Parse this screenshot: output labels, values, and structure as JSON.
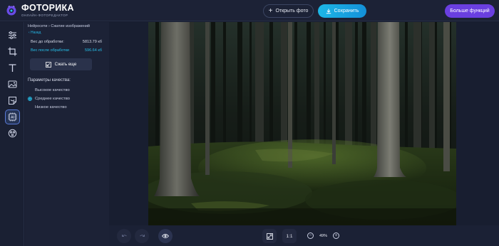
{
  "app": {
    "title": "ФОТОРИКА",
    "subtitle": "ОНЛАЙН-ФОТОРЕДАКТОР"
  },
  "header": {
    "open_label": "Открыть фото",
    "save_label": "Сохранить",
    "more_label": "Больше функций"
  },
  "toolbar": {
    "tools": [
      {
        "name": "adjust-icon"
      },
      {
        "name": "crop-icon"
      },
      {
        "name": "text-icon"
      },
      {
        "name": "image-icon"
      },
      {
        "name": "sticker-icon"
      },
      {
        "name": "ai-icon",
        "active": true
      },
      {
        "name": "effects-icon"
      }
    ]
  },
  "panel": {
    "breadcrumb": "Нейросети › Сжатие изображений",
    "back_label": "‹ Назад",
    "weight_before_label": "Вес до обработки:",
    "weight_before_value": "5813.79 кб",
    "weight_after_label": "Вес после обработки",
    "weight_after_value": "596.64 кб",
    "compress_label": "Сжать еще",
    "params_title": "Параметры качества:",
    "quality_options": [
      {
        "label": "Высокое качество",
        "selected": false
      },
      {
        "label": "Среднее качество",
        "selected": true
      },
      {
        "label": "Низкое качество",
        "selected": false
      }
    ]
  },
  "bottom": {
    "ratio_label": "1:1",
    "zoom_value": "49%"
  },
  "colors": {
    "accent_cyan": "#25c0ea",
    "save_gradient_start": "#1db7e6",
    "more_purple": "#6a3fe0",
    "background": "#181e30"
  }
}
